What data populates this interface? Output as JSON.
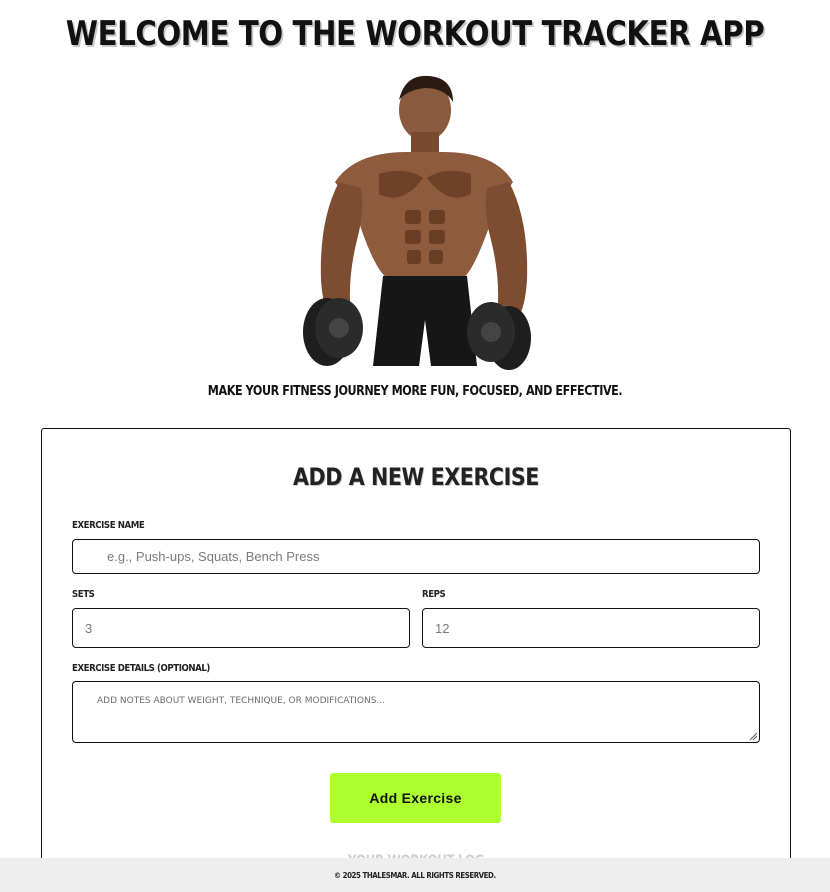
{
  "header": {
    "title": "Welcome to the Workout Tracker App",
    "tagline": "Make your fitness journey more fun, focused, and effective."
  },
  "hero": {
    "icon": "athlete-with-dumbbells-image"
  },
  "form": {
    "title": "Add a New Exercise",
    "exercise_name": {
      "label": "Exercise Name",
      "placeholder": "e.g., Push-ups, Squats, Bench Press",
      "value": ""
    },
    "sets": {
      "label": "Sets",
      "placeholder": "3",
      "value": ""
    },
    "reps": {
      "label": "Reps",
      "placeholder": "12",
      "value": ""
    },
    "details": {
      "label": "Exercise Details (Optional)",
      "placeholder": "Add notes about weight, technique, or modifications...",
      "value": ""
    },
    "submit_label": "Add Exercise",
    "accent_color": "#adff2f"
  },
  "workout_log": {
    "heading": "Your Workout Log"
  },
  "footer": {
    "text": "© 2025 Thalesmar. All rights reserved."
  }
}
